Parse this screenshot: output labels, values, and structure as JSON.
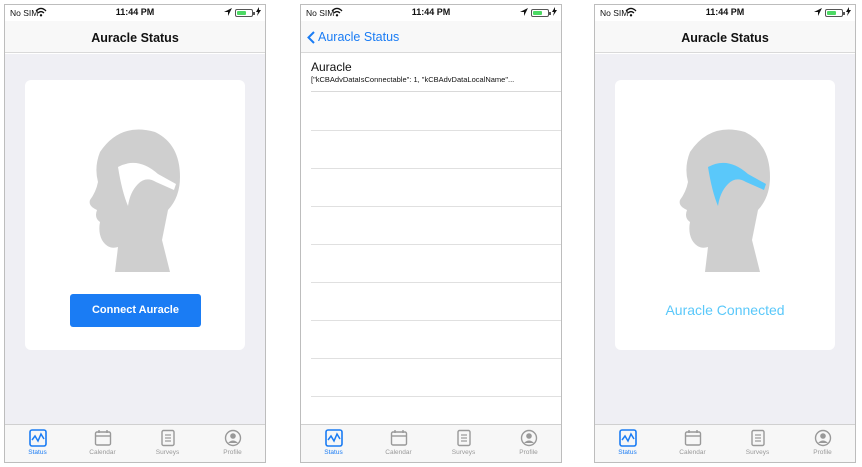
{
  "status_bar": {
    "carrier": "No SIM",
    "time": "11:44 PM"
  },
  "screens": [
    {
      "nav_title": "Auracle Status",
      "button_label": "Connect Auracle"
    },
    {
      "back_label": "Auracle Status",
      "devices": [
        {
          "name": "Auracle",
          "detail": "[\"kCBAdvDataIsConnectable\": 1, \"kCBAdvDataLocalName\"..."
        }
      ]
    },
    {
      "nav_title": "Auracle Status",
      "connected_label": "Auracle Connected"
    }
  ],
  "tabs": [
    {
      "label": "Status",
      "icon": "status-icon",
      "active": true
    },
    {
      "label": "Calendar",
      "icon": "calendar-icon",
      "active": false
    },
    {
      "label": "Surveys",
      "icon": "surveys-icon",
      "active": false
    },
    {
      "label": "Profile",
      "icon": "profile-icon",
      "active": false
    }
  ],
  "colors": {
    "accent": "#1a7cf4",
    "connected": "#5ac8fa",
    "background": "#efeff4",
    "head": "#cfcfcf"
  }
}
